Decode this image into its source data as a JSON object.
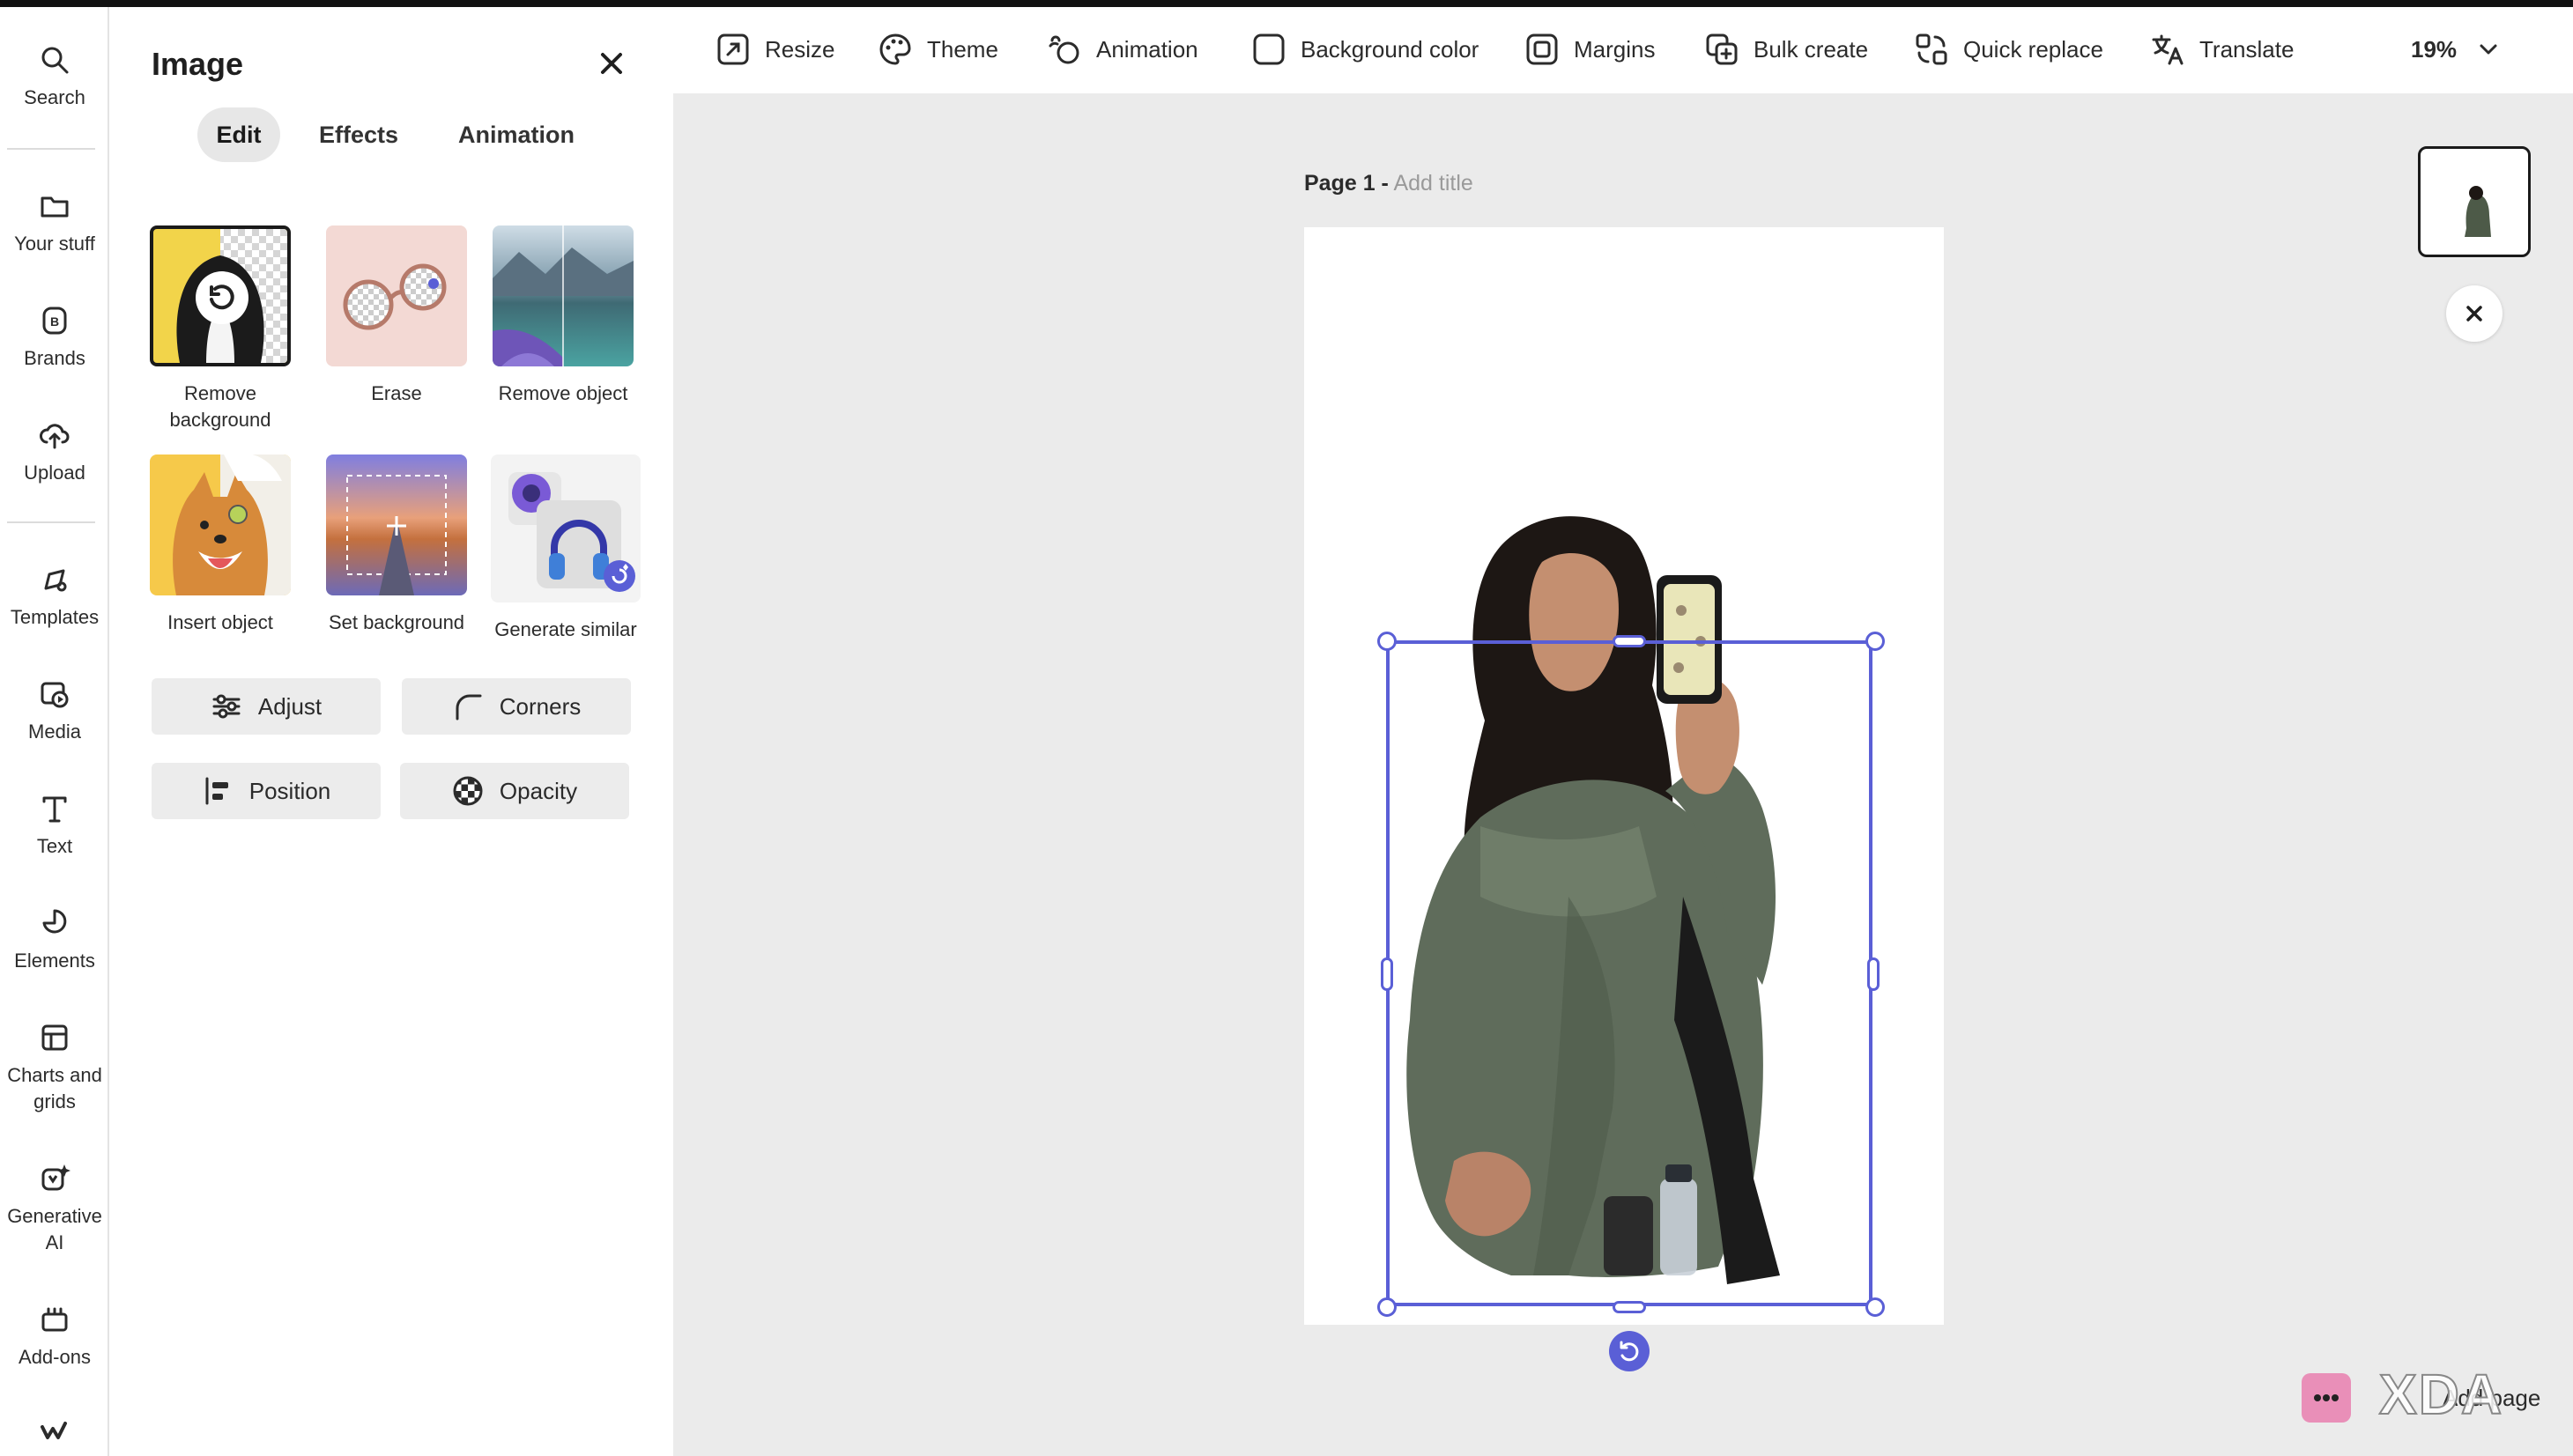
{
  "rail": {
    "items": [
      {
        "label": "Search",
        "icon": "search-icon"
      },
      {
        "label": "Your stuff",
        "icon": "folder-icon"
      },
      {
        "label": "Brands",
        "icon": "brand-icon"
      },
      {
        "label": "Upload",
        "icon": "upload-cloud-icon"
      },
      {
        "label": "Templates",
        "icon": "templates-icon"
      },
      {
        "label": "Media",
        "icon": "media-icon"
      },
      {
        "label": "Text",
        "icon": "text-icon"
      },
      {
        "label": "Elements",
        "icon": "elements-icon"
      },
      {
        "label": "Charts and grids",
        "icon": "charts-grid-icon"
      },
      {
        "label": "Generative AI",
        "icon": "generative-ai-icon"
      },
      {
        "label": "Add-ons",
        "icon": "add-ons-icon"
      }
    ]
  },
  "panel": {
    "title": "Image",
    "tabs": [
      {
        "label": "Edit",
        "active": true
      },
      {
        "label": "Effects",
        "active": false
      },
      {
        "label": "Animation",
        "active": false
      }
    ],
    "tools": [
      {
        "label": "Remove background"
      },
      {
        "label": "Erase"
      },
      {
        "label": "Remove object"
      },
      {
        "label": "Insert object"
      },
      {
        "label": "Set background"
      },
      {
        "label": "Generate similar"
      }
    ],
    "buttons": [
      {
        "label": "Adjust",
        "icon": "sliders-icon"
      },
      {
        "label": "Corners",
        "icon": "corner-icon"
      },
      {
        "label": "Position",
        "icon": "align-left-icon"
      },
      {
        "label": "Opacity",
        "icon": "checker-icon"
      }
    ]
  },
  "toolbar": {
    "items": [
      {
        "label": "Resize",
        "icon": "resize-icon"
      },
      {
        "label": "Theme",
        "icon": "palette-icon"
      },
      {
        "label": "Animation",
        "icon": "animation-icon"
      },
      {
        "label": "Background color",
        "icon": "color-swatch-icon"
      },
      {
        "label": "Margins",
        "icon": "margins-icon"
      },
      {
        "label": "Bulk create",
        "icon": "bulk-create-icon"
      },
      {
        "label": "Quick replace",
        "icon": "quick-replace-icon"
      },
      {
        "label": "Translate",
        "icon": "translate-icon"
      }
    ],
    "zoom": "19%"
  },
  "canvas": {
    "page_label": "Page 1 -",
    "title_placeholder": "Add title"
  },
  "footer": {
    "add_page": "Add page",
    "watermark": "XDA"
  },
  "colors": {
    "selection": "#5a5fd6",
    "canvas_bg": "#ebebeb"
  }
}
